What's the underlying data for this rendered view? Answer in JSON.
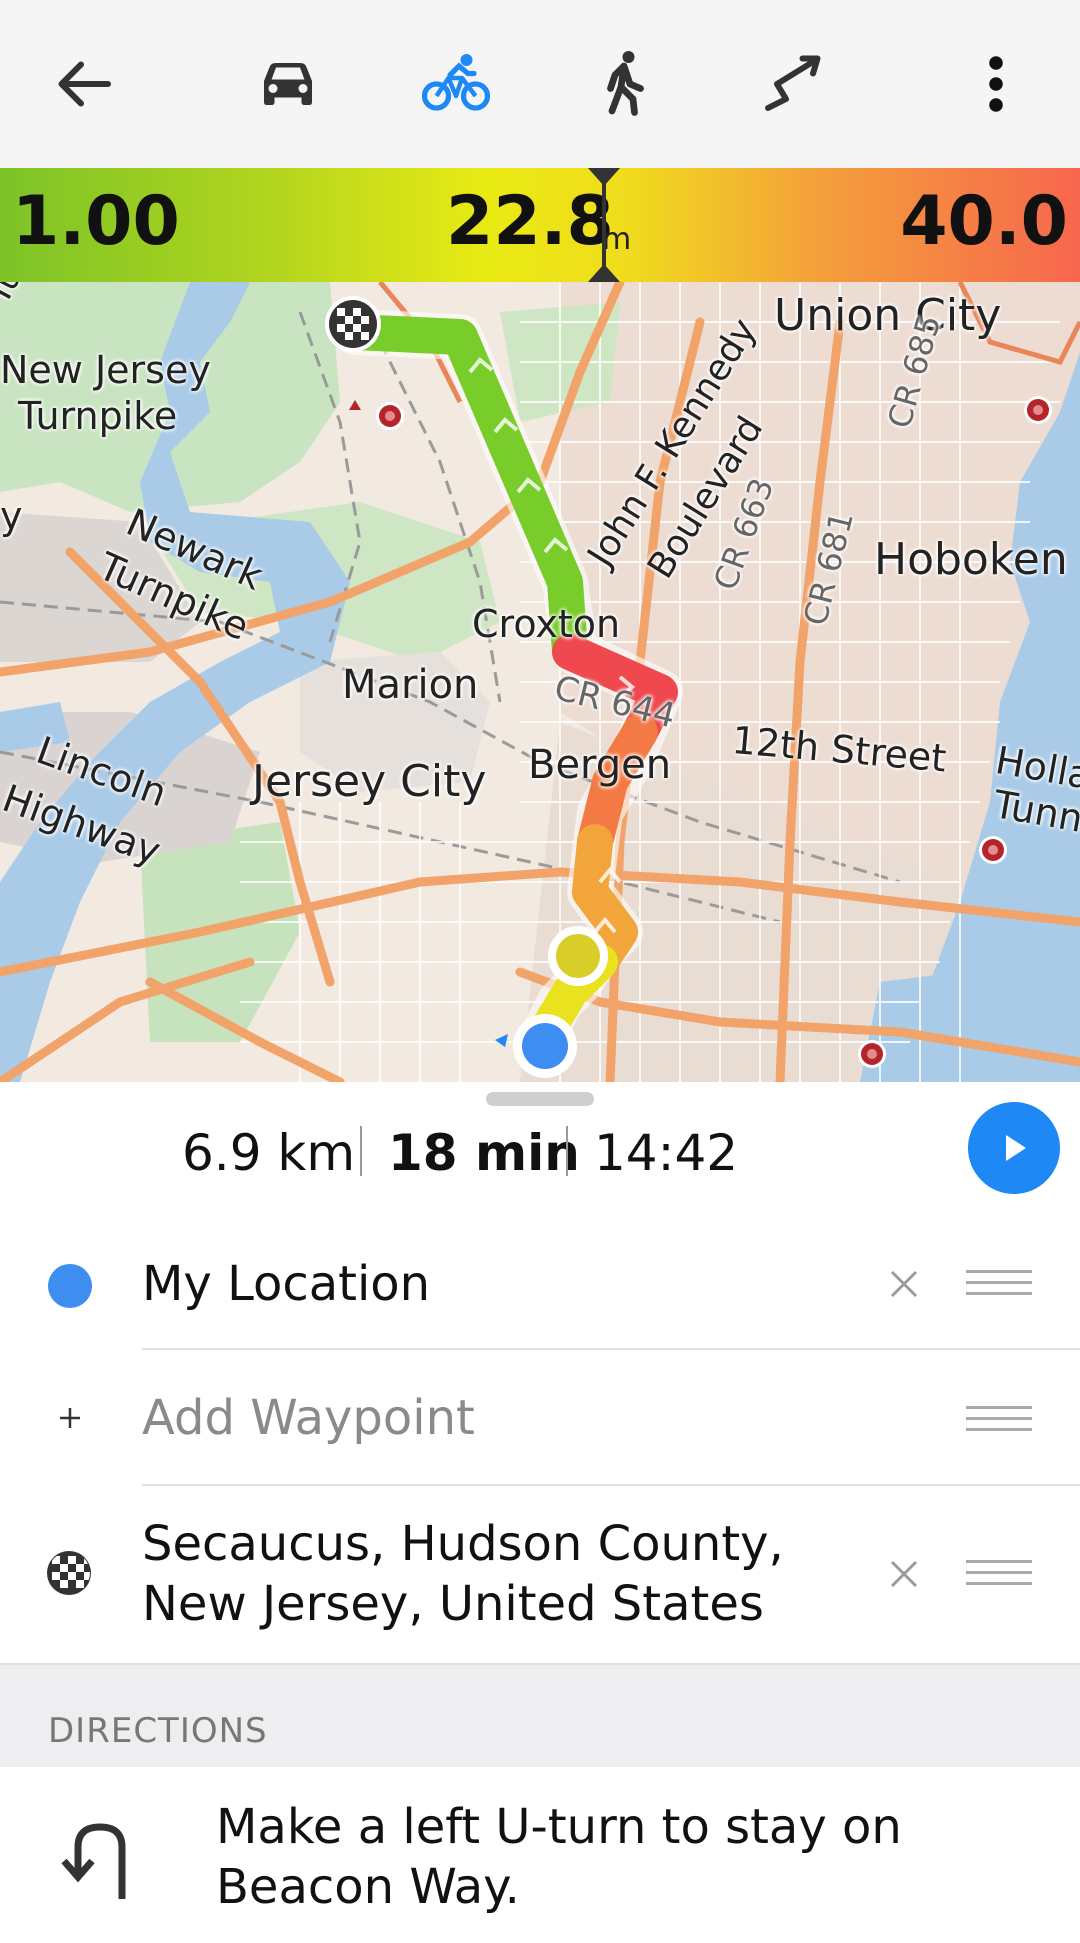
{
  "toolbar": {
    "back_icon": "arrow-left-icon",
    "modes": [
      {
        "name": "car",
        "icon": "car-icon",
        "active": false
      },
      {
        "name": "bicycle",
        "icon": "bicycle-icon",
        "active": true
      },
      {
        "name": "walk",
        "icon": "pedestrian-icon",
        "active": false
      },
      {
        "name": "direct",
        "icon": "straight-line-icon",
        "active": false
      }
    ],
    "menu_icon": "more-vertical-icon",
    "active_color": "#1e88f5"
  },
  "elevation": {
    "min": "1.00",
    "current": "22.8",
    "unit": "m",
    "max": "40.0"
  },
  "map": {
    "labels": {
      "union_city": "Union City",
      "new_jersey_turnpike_1": "New Jersey",
      "new_jersey_turnpike_2": "Turnpike",
      "newark_1": "Newark",
      "newark_2": "Turnpike",
      "jfk_1": "John F. Kennedy",
      "jfk_2": "Boulevard",
      "cr663": "CR 663",
      "cr681": "CR 681",
      "cr685": "CR 685",
      "hoboken": "Hoboken",
      "croxton": "Croxton",
      "marion": "Marion",
      "cr644": "CR 644",
      "twelfth": "12th Street",
      "lincoln_1": "Lincoln",
      "lincoln_2": "Highway",
      "jersey_city": "Jersey City",
      "bergen": "Bergen",
      "holland_1": "Hollan",
      "holland_2": "Tunn",
      "partial_top": "Turnpi",
      "partial_left": "y"
    }
  },
  "summary": {
    "distance": "6.9 km",
    "duration": "18 min",
    "arrival": "14:42",
    "start_icon": "play-icon"
  },
  "waypoints": [
    {
      "text": "My Location",
      "icon": "current-location-dot-icon",
      "removable": true
    },
    {
      "text": "Add Waypoint",
      "icon": "plus-icon",
      "placeholder": true,
      "removable": false
    },
    {
      "text": "Secaucus, Hudson County, New Jersey, United States",
      "icon": "checkered-flag-icon",
      "removable": true
    }
  ],
  "directions": {
    "header": "DIRECTIONS",
    "items": [
      {
        "icon": "u-turn-left-icon",
        "text": "Make a left U-turn to stay on Beacon Way."
      }
    ]
  }
}
